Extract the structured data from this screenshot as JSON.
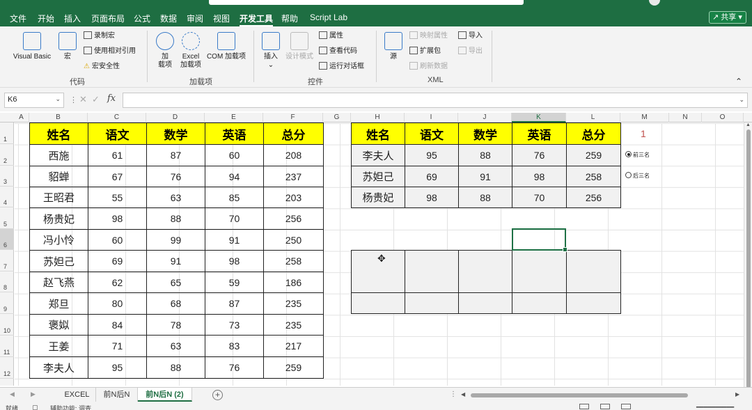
{
  "menu": {
    "items": [
      "文件",
      "开始",
      "插入",
      "页面布局",
      "公式",
      "数据",
      "审阅",
      "视图",
      "开发工具",
      "帮助",
      "Script Lab"
    ],
    "active": "开发工具",
    "share": "共享"
  },
  "ribbon": {
    "groups": {
      "code": "代码",
      "addins": "加载项",
      "controls": "控件",
      "xml": "XML"
    },
    "visual_basic": "Visual Basic",
    "macros": "宏",
    "record_macro": "录制宏",
    "relative_ref": "使用相对引用",
    "macro_security": "宏安全性",
    "addins": "加\n载项",
    "excel_addins": "Excel\n加载项",
    "com_addins": "COM 加载项",
    "insert": "插入",
    "design_mode": "设计模式",
    "properties": "属性",
    "view_code": "查看代码",
    "run_dialog": "运行对话框",
    "source": "源",
    "map_properties": "映射属性",
    "expansion_packs": "扩展包",
    "refresh_data": "刷新数据",
    "import": "导入",
    "export": "导出"
  },
  "formula_bar": {
    "name_box": "K6",
    "fx": "fx",
    "formula": ""
  },
  "columns": [
    "A",
    "B",
    "C",
    "D",
    "E",
    "F",
    "G",
    "H",
    "I",
    "J",
    "K",
    "L",
    "M",
    "N",
    "O"
  ],
  "selected_column": "K",
  "rows": [
    "1",
    "2",
    "3",
    "4",
    "5",
    "6",
    "7",
    "8",
    "9",
    "10",
    "11",
    "12"
  ],
  "table1": {
    "headers": [
      "姓名",
      "语文",
      "数学",
      "英语",
      "总分"
    ],
    "rows": [
      [
        "西施",
        "61",
        "87",
        "60",
        "208"
      ],
      [
        "貂蝉",
        "67",
        "76",
        "94",
        "237"
      ],
      [
        "王昭君",
        "55",
        "63",
        "85",
        "203"
      ],
      [
        "杨贵妃",
        "98",
        "88",
        "70",
        "256"
      ],
      [
        "冯小怜",
        "60",
        "99",
        "91",
        "250"
      ],
      [
        "苏妲己",
        "69",
        "91",
        "98",
        "258"
      ],
      [
        "赵飞燕",
        "62",
        "65",
        "59",
        "186"
      ],
      [
        "郑旦",
        "80",
        "68",
        "87",
        "235"
      ],
      [
        "褒姒",
        "84",
        "78",
        "73",
        "235"
      ],
      [
        "王姜",
        "71",
        "63",
        "83",
        "217"
      ],
      [
        "李夫人",
        "95",
        "88",
        "76",
        "259"
      ]
    ]
  },
  "table2": {
    "headers": [
      "姓名",
      "语文",
      "数学",
      "英语",
      "总分"
    ],
    "rows": [
      [
        "李夫人",
        "95",
        "88",
        "76",
        "259"
      ],
      [
        "苏妲己",
        "69",
        "91",
        "98",
        "258"
      ],
      [
        "杨贵妃",
        "98",
        "88",
        "70",
        "256"
      ]
    ]
  },
  "m1_value": "1",
  "radio": {
    "option1": "前三名",
    "option2": "后三名"
  },
  "sheets": [
    "EXCEL",
    "前N后N",
    "前N后N (2)"
  ],
  "active_sheet": "前N后N (2)",
  "status": {
    "ready": "就绪",
    "accessibility": "辅助功能: 调查"
  }
}
